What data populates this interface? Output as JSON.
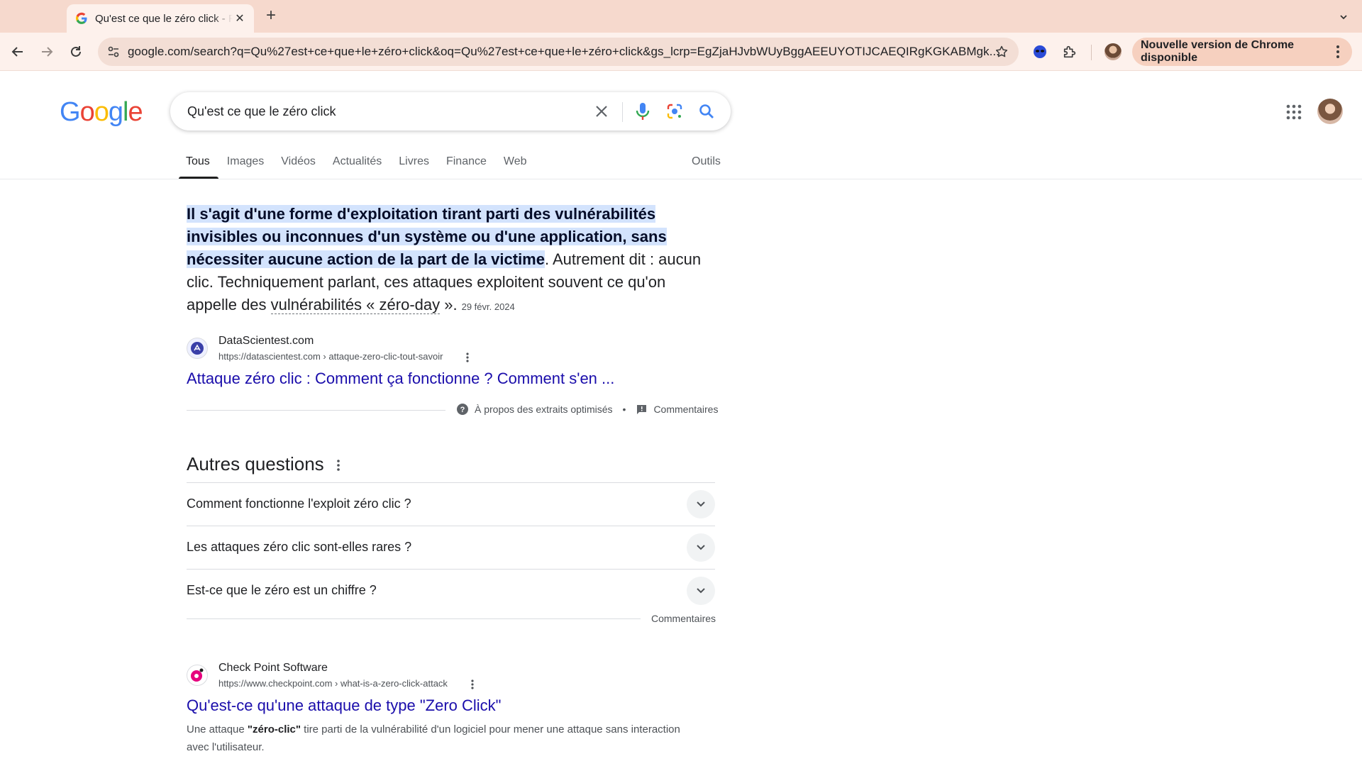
{
  "browser": {
    "tab_title": "Qu'est ce que le zéro click - Recherche Google",
    "url_host": "google.com",
    "url_path": "/search?q=Qu%27est+ce+que+le+zéro+click&oq=Qu%27est+ce+que+le+zéro+click&gs_lcrp=EgZjaHJvbWUyBggAEEUYOTIJCAEQIRgKGKABMgk...",
    "update_label": "Nouvelle version de Chrome disponible"
  },
  "search": {
    "logo": [
      "G",
      "o",
      "o",
      "g",
      "l",
      "e"
    ],
    "logo_colors": [
      "#4285F4",
      "#EA4335",
      "#FBBC05",
      "#4285F4",
      "#34A853",
      "#EA4335"
    ],
    "query": "Qu'est ce que le zéro click"
  },
  "tabs": [
    {
      "label": "Tous",
      "active": true
    },
    {
      "label": "Images"
    },
    {
      "label": "Vidéos"
    },
    {
      "label": "Actualités"
    },
    {
      "label": "Livres"
    },
    {
      "label": "Finance"
    },
    {
      "label": "Web"
    }
  ],
  "tools_label": "Outils",
  "snippet": {
    "highlight": "Il s'agit d'une forme d'exploitation tirant parti des vulnérabilités invisibles ou inconnues d'un système ou d'une application, sans nécessiter aucune action de la part de la victime",
    "rest_1": ". Autrement dit : aucun clic. Techniquement parlant, ces attaques exploitent souvent ce qu'on appelle des ",
    "term": "vulnérabilités « zéro-day",
    "rest_2": " ».",
    "date": "29 févr. 2024",
    "source_name": "DataScientest.com",
    "source_url": "https://datascientest.com › attaque-zero-clic-tout-savoir",
    "link": "Attaque zéro clic : Comment ça fonctionne ? Comment s'en ...",
    "about_label": "À propos des extraits optimisés",
    "feedback_label": "Commentaires"
  },
  "paa": {
    "title": "Autres questions",
    "questions": [
      "Comment fonctionne l'exploit zéro clic ?",
      "Les attaques zéro clic sont-elles rares ?",
      "Est-ce que le zéro est un chiffre ?"
    ],
    "feedback_label": "Commentaires"
  },
  "result2": {
    "source_name": "Check Point Software",
    "source_url": "https://www.checkpoint.com › what-is-a-zero-click-attack",
    "title": "Qu'est-ce qu'une attaque de type \"Zero Click\"",
    "desc_1": "Une attaque ",
    "desc_bold": "\"zéro-clic\"",
    "desc_2": " tire parti de la vulnérabilité d'un logiciel pour mener une attaque sans interaction avec l'utilisateur."
  }
}
